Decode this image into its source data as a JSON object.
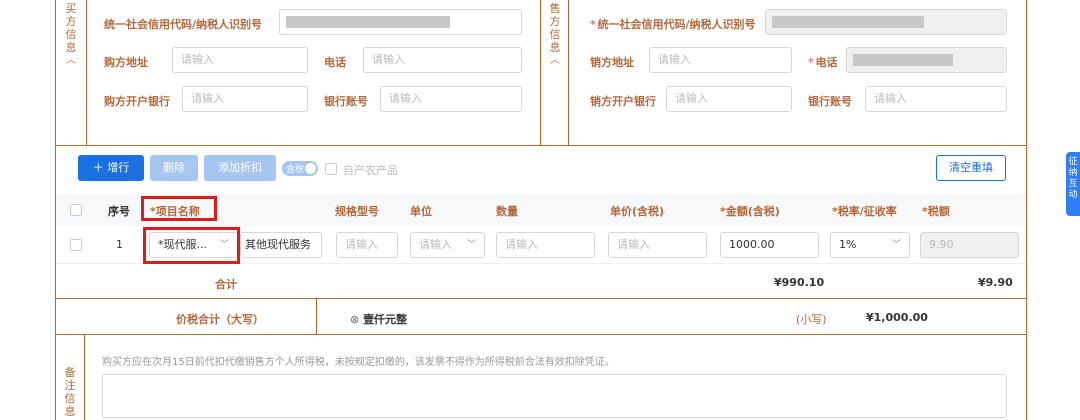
{
  "buyer": {
    "side_label": "买方信息",
    "collapse_icon": "chevron-up-icon",
    "tax_id_label": "统一社会信用代码/纳税人识别号",
    "address_label": "购方地址",
    "address_placeholder": "请输入",
    "phone_label": "电话",
    "phone_placeholder": "请输入",
    "bank_label": "购方开户银行",
    "bank_placeholder": "请输入",
    "account_label": "银行账号",
    "account_placeholder": "请输入"
  },
  "seller": {
    "side_label": "售方信息",
    "tax_id_label": "统一社会信用代码/纳税人识别号",
    "address_label": "销方地址",
    "address_placeholder": "请输入",
    "phone_label": "电话",
    "bank_label": "销方开户银行",
    "bank_placeholder": "请输入",
    "account_label": "银行账号",
    "account_placeholder": "请输入"
  },
  "toolbar": {
    "add_row": "增行",
    "delete": "删除",
    "add_discount": "添加折扣",
    "tax_included_toggle": "含税",
    "self_produced": "自产农产品",
    "clear": "清空重填"
  },
  "table": {
    "headers": {
      "index": "序号",
      "item_name": "*项目名称",
      "spec": "规格型号",
      "unit": "单位",
      "quantity": "数量",
      "unit_price": "单价(含税)",
      "amount": "*金额(含税)",
      "tax_rate": "*税率/征收率",
      "tax": "*税额"
    },
    "rows": [
      {
        "index": "1",
        "item_category": "*现代服...",
        "item_name": "其他现代服务",
        "spec_placeholder": "请输入",
        "unit_placeholder": "请输入",
        "quantity_placeholder": "请输入",
        "unit_price_placeholder": "请输入",
        "amount": "1000.00",
        "tax_rate": "1%",
        "tax": "9.90"
      }
    ],
    "subtotal_label": "合计",
    "subtotal_amount": "¥990.10",
    "subtotal_tax": "¥9.90"
  },
  "grand_total": {
    "label": "价税合计（大写）",
    "in_words": "壹仟元整",
    "small_label": "(小写)",
    "in_figures": "¥1,000.00"
  },
  "remarks": {
    "side_label": "备注信息",
    "note": "购买方应在次月15日前代扣代缴销售方个人所得税，未按规定扣缴的，该发票不得作为所得税前合法有效扣除凭证。"
  },
  "side_tab": {
    "label": "征纳互动"
  },
  "colors": {
    "frame": "#b5683a",
    "primary": "#1a6fe3",
    "highlight": "#e01b1b"
  }
}
